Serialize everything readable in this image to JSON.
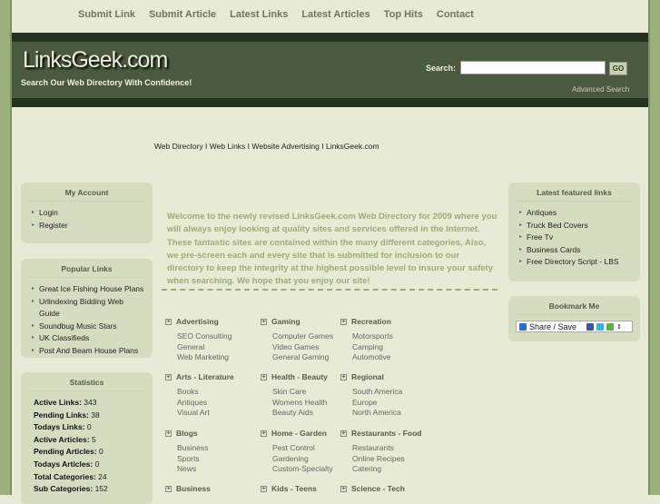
{
  "nav": [
    "Submit Link",
    "Submit Article",
    "Latest Links",
    "Latest Articles",
    "Top Hits",
    "Contact"
  ],
  "header": {
    "logo": "LinksGeek.com",
    "tagline": "Search Our Web Directory With Confidence!",
    "search_label": "Search:",
    "search_value": "",
    "go": "GO",
    "advanced": "Advanced Search"
  },
  "crumb": "Web Directory I Web Links I Website Advertising I LinksGeek.com",
  "account": {
    "title": "My Account",
    "items": [
      "Login",
      "Register"
    ]
  },
  "popular": {
    "title": "Popular Links",
    "items": [
      "Great Ice Fishing House Plans",
      "Urlindexing Bidding Web Guide",
      "Soundbug Music Stars",
      "UK Classifieds",
      "Post And Beam House Plans"
    ]
  },
  "stats": {
    "title": "Statistics",
    "rows": [
      [
        "Active Links:",
        "343"
      ],
      [
        "Pending Links:",
        "38"
      ],
      [
        "Todays Links:",
        "0"
      ],
      [
        "Active Articles:",
        "5"
      ],
      [
        "Pending Articles:",
        "0"
      ],
      [
        "Todays Articles:",
        "0"
      ],
      [
        "Total Categories:",
        "24"
      ],
      [
        "Sub Categories:",
        "152"
      ]
    ]
  },
  "featured": {
    "title": "Latest featured links",
    "items": [
      "Antiques",
      "Truck Bed Covers",
      "Free Tv",
      "Business Cards",
      "Free Directory Script - LBS"
    ]
  },
  "bookmark": {
    "title": "Bookmark Me",
    "share": "Share / Save"
  },
  "welcome": "Welcome to the newly revised LinksGeek.com Web Directory for 2009 where you will always enjoy looking at quality sites and services offered in the Internet. These fantastic sites are contained within the many different categories, Also, we pre-screen each and every site that is submitted for inclusion to our directory to keep the integrity at the highest possible level to insure your safety when searching. We hope that you enjoy our site!",
  "categories": [
    {
      "name": "Advertising",
      "subs": [
        "SEO Consulting",
        "General",
        "Web Marketing"
      ]
    },
    {
      "name": "Gaming",
      "subs": [
        "Computer Games",
        "Video Games",
        "General Gaming"
      ]
    },
    {
      "name": "Recreation",
      "subs": [
        "Motorsports",
        "Camping",
        "Automotive"
      ]
    },
    {
      "name": "Arts - Literature",
      "subs": [
        "Books",
        "Antiques",
        "Visual Art"
      ]
    },
    {
      "name": "Health - Beauty",
      "subs": [
        "Skin Care",
        "Womens Health",
        "Beauty Aids"
      ]
    },
    {
      "name": "Regional",
      "subs": [
        "South America",
        "Europe",
        "North America"
      ]
    },
    {
      "name": "Blogs",
      "subs": [
        "Business",
        "Sports",
        "News"
      ]
    },
    {
      "name": "Home - Garden",
      "subs": [
        "Pest Control",
        "Gardening",
        "Custom-Specialty"
      ]
    },
    {
      "name": "Restaurants - Food",
      "subs": [
        "Restaurants",
        "Online Recipes",
        "Catering"
      ]
    },
    {
      "name": "Business",
      "subs": []
    },
    {
      "name": "Kids - Teens",
      "subs": []
    },
    {
      "name": "Science - Tech",
      "subs": []
    }
  ]
}
